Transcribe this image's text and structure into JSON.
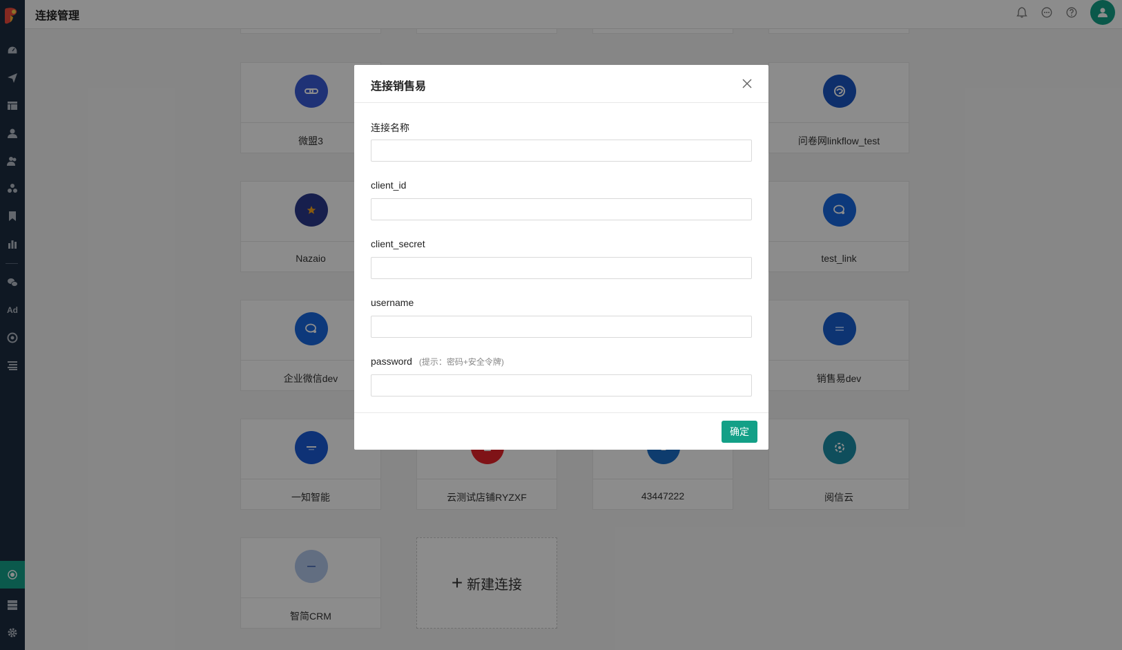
{
  "header": {
    "title": "连接管理"
  },
  "sidebar": {
    "items": [
      {
        "icon": "dashboard-icon"
      },
      {
        "icon": "send-icon"
      },
      {
        "icon": "layout-icon"
      },
      {
        "icon": "user-icon"
      },
      {
        "icon": "users-icon"
      },
      {
        "icon": "group-icon"
      },
      {
        "icon": "bookmark-icon"
      },
      {
        "icon": "bar-chart-icon"
      },
      {
        "icon": "wechat-icon"
      },
      {
        "icon": "ad-icon",
        "text": "Ad"
      },
      {
        "icon": "target-icon"
      },
      {
        "icon": "list-icon"
      },
      {
        "icon": "connection-icon"
      },
      {
        "icon": "storage-icon"
      },
      {
        "icon": "gear-icon"
      }
    ]
  },
  "cards": [
    {
      "label": "微盟3",
      "color": "#3a5bd8",
      "icon": "link-icon"
    },
    {
      "label": "问卷网linkflow_test",
      "color": "#1a56c4",
      "icon": "wenjuan-icon"
    },
    {
      "label": "Nazaio",
      "color": "#2a3a8c",
      "icon": "star-icon"
    },
    {
      "label": "test_link",
      "color": "#1868e0",
      "icon": "chat-icon"
    },
    {
      "label": "企业微信dev",
      "color": "#1868e0",
      "icon": "chat-icon"
    },
    {
      "label": "销售易dev",
      "color": "#1860d0",
      "icon": "xiaoshouyi-icon"
    },
    {
      "label": "一知智能",
      "color": "#1a5cd8",
      "icon": "yizhi-icon"
    },
    {
      "label": "云测试店铺RYZXF",
      "color": "#e8232b",
      "icon": "shop-icon"
    },
    {
      "label": "43447222",
      "color": "#1a6ec8",
      "icon": "app-icon"
    },
    {
      "label": "阅信云",
      "color": "#1d8fa8",
      "icon": "yuexin-icon"
    },
    {
      "label": "智简CRM",
      "color": "#b3c8ec",
      "icon": "crm-icon"
    }
  ],
  "new_connection": {
    "plus": "+",
    "label": "新建连接"
  },
  "modal": {
    "title": "连接销售易",
    "fields": [
      {
        "label": "连接名称",
        "value": ""
      },
      {
        "label": "client_id",
        "value": ""
      },
      {
        "label": "client_secret",
        "value": ""
      },
      {
        "label": "username",
        "value": ""
      },
      {
        "label": "password",
        "hint": "(提示：密码+安全令牌)",
        "value": ""
      }
    ],
    "ok_label": "确定"
  },
  "colors": {
    "accent": "#13a087",
    "sidebar": "#1d2d40"
  }
}
